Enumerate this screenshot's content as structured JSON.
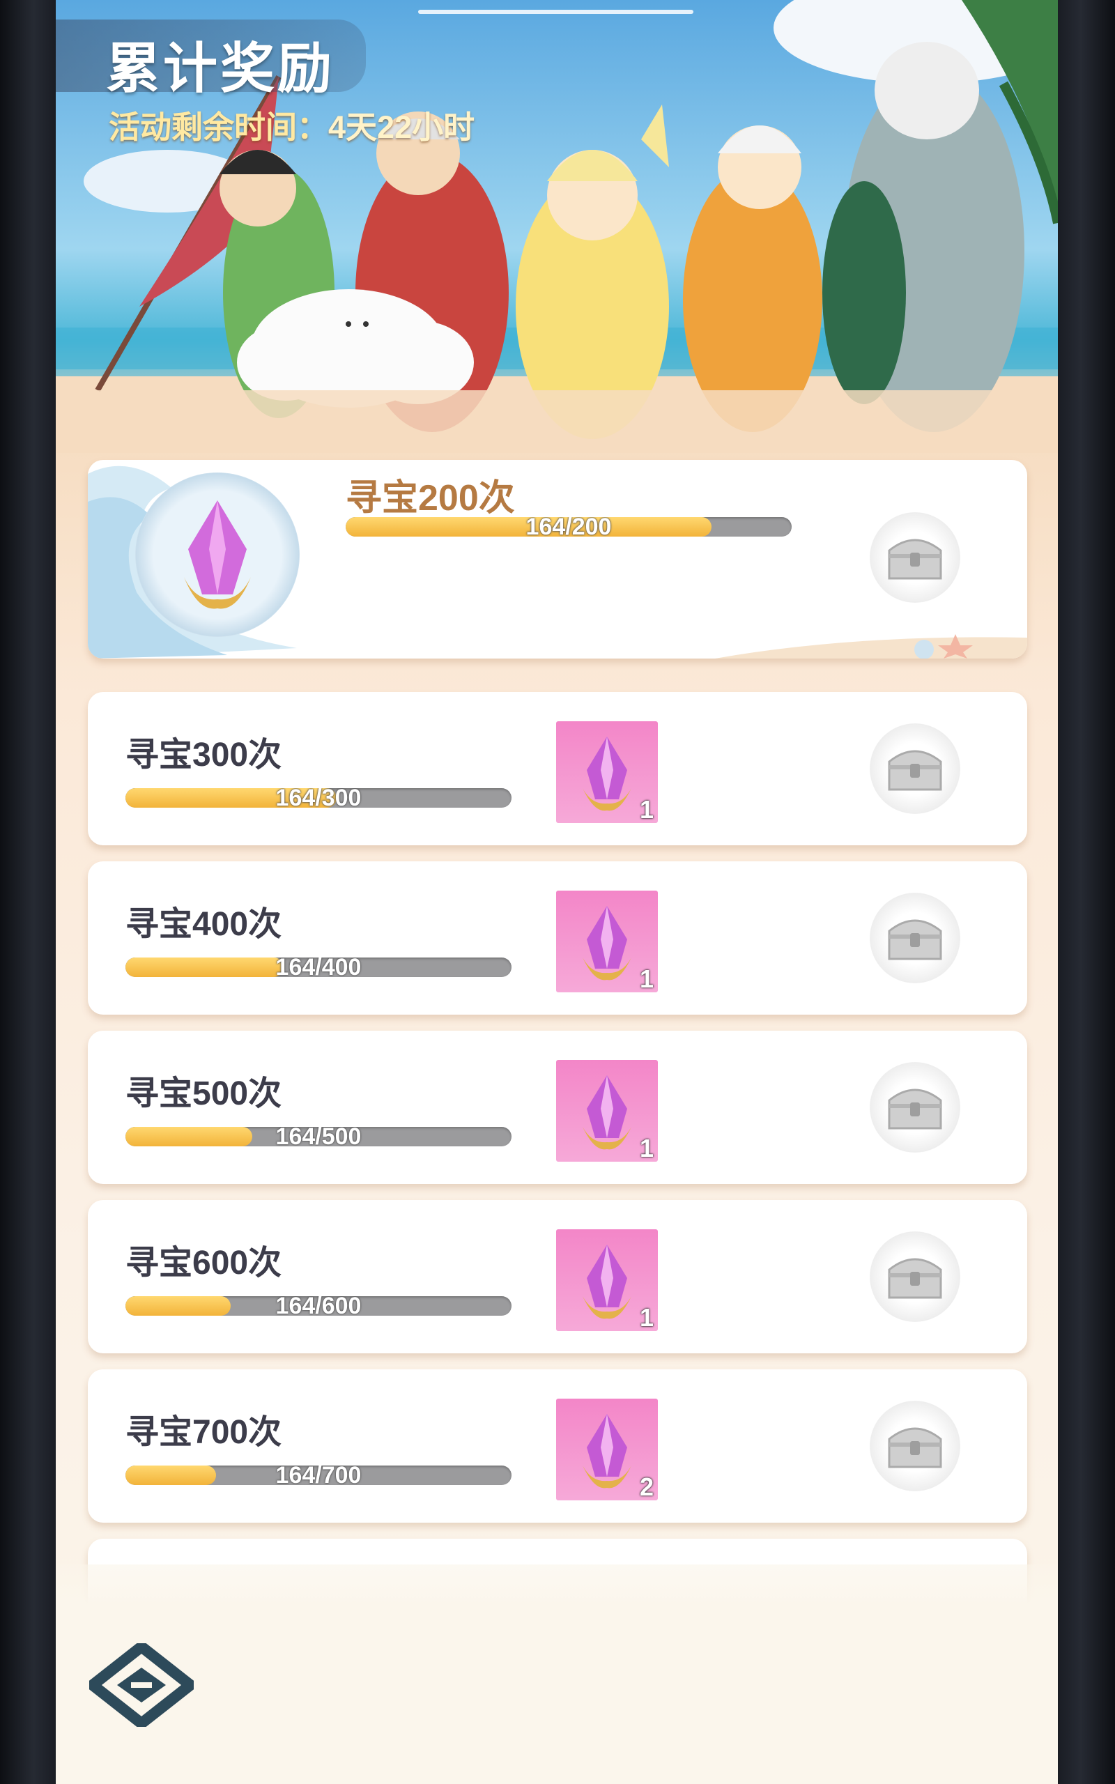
{
  "header": {
    "title": "累计奖励",
    "time_label": "活动剩余时间：",
    "time_value": "4天22小时"
  },
  "featured": {
    "label": "寻宝200次",
    "progress_text": "164/200",
    "progress_fraction": 0.82
  },
  "tasks": [
    {
      "label": "寻宝300次",
      "progress_text": "164/300",
      "progress_fraction": 0.547,
      "reward_count": "1"
    },
    {
      "label": "寻宝400次",
      "progress_text": "164/400",
      "progress_fraction": 0.41,
      "reward_count": "1"
    },
    {
      "label": "寻宝500次",
      "progress_text": "164/500",
      "progress_fraction": 0.328,
      "reward_count": "1"
    },
    {
      "label": "寻宝600次",
      "progress_text": "164/600",
      "progress_fraction": 0.273,
      "reward_count": "1"
    },
    {
      "label": "寻宝700次",
      "progress_text": "164/700",
      "progress_fraction": 0.234,
      "reward_count": "2"
    }
  ],
  "colors": {
    "progress_fill": "#f2b33a",
    "progress_track": "#9b9b9d",
    "reward_bg": "#f386c8",
    "featured_label": "#b57a42"
  },
  "icons": {
    "reward": "pink-crystal-icon",
    "chest": "treasure-chest-icon",
    "logo": "diamond-logo-icon"
  }
}
